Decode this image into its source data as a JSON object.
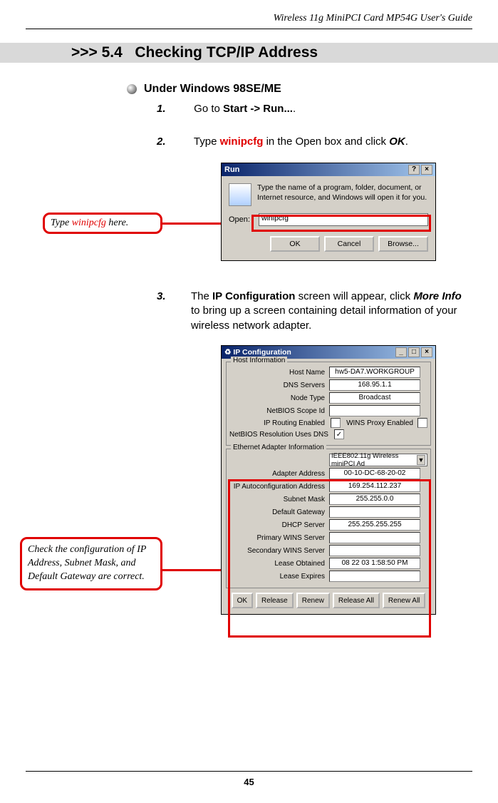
{
  "header": "Wireless 11g MiniPCI Card MP54G User's Guide",
  "section": {
    "number": ">>> 5.4",
    "title": "Checking TCP/IP Address"
  },
  "subtitle": "Under Windows 98SE/ME",
  "steps": {
    "s1": {
      "num": "1.",
      "pre": "Go to ",
      "bold": "Start -> Run...",
      "post": "."
    },
    "s2": {
      "num": "2.",
      "pre": "Type ",
      "red": "winipcfg",
      "mid": " in the Open box and click ",
      "bold": "OK",
      "post": "."
    },
    "s3": {
      "num": "3.",
      "pre": "The ",
      "bold1": "IP Configuration",
      "mid1": " screen will appear, click ",
      "bold2": "More Info",
      "post": " to bring up a screen containing detail information of your wireless network adapter."
    }
  },
  "callout1": {
    "pre": "Type ",
    "red": "winipcfg",
    "post": " here."
  },
  "callout2": "Check the configuration of IP Address, Subnet Mask, and Default Gateway are correct.",
  "run": {
    "title": "Run",
    "help": "?",
    "close": "×",
    "msg": "Type the name of a program, folder, document, or Internet resource, and Windows will open it for you.",
    "open_label": "Open:",
    "open_value": "winipcfg",
    "ok": "OK",
    "cancel": "Cancel",
    "browse": "Browse..."
  },
  "ip": {
    "title": "IP Configuration",
    "min": "_",
    "max": "□",
    "close": "×",
    "host_group": "Host Information",
    "adapter_group": "Ethernet Adapter Information",
    "host_name_l": "Host Name",
    "host_name_v": "hw5-DA7.WORKGROUP",
    "dns_l": "DNS Servers",
    "dns_v": "168.95.1.1",
    "node_l": "Node Type",
    "node_v": "Broadcast",
    "netbios_l": "NetBIOS Scope Id",
    "netbios_v": "",
    "routing_l": "IP Routing Enabled",
    "wins_proxy_l": "WINS Proxy Enabled",
    "netbios_dns_l": "NetBIOS Resolution Uses DNS",
    "adapter_dd": "IEEE802.11g Wireless miniPCI Ad",
    "addr_l": "Adapter Address",
    "addr_v": "00-10-DC-68-20-02",
    "autocfg_l": "IP Autoconfiguration Address",
    "autocfg_v": "169.254.112.237",
    "subnet_l": "Subnet Mask",
    "subnet_v": "255.255.0.0",
    "gw_l": "Default Gateway",
    "gw_v": "",
    "dhcp_l": "DHCP Server",
    "dhcp_v": "255.255.255.255",
    "pwins_l": "Primary WINS Server",
    "pwins_v": "",
    "swins_l": "Secondary WINS Server",
    "swins_v": "",
    "lease_obt_l": "Lease Obtained",
    "lease_obt_v": "08 22 03 1:58:50 PM",
    "lease_exp_l": "Lease Expires",
    "lease_exp_v": "",
    "ok": "OK",
    "release": "Release",
    "renew": "Renew",
    "release_all": "Release All",
    "renew_all": "Renew All"
  },
  "page_number": "45"
}
